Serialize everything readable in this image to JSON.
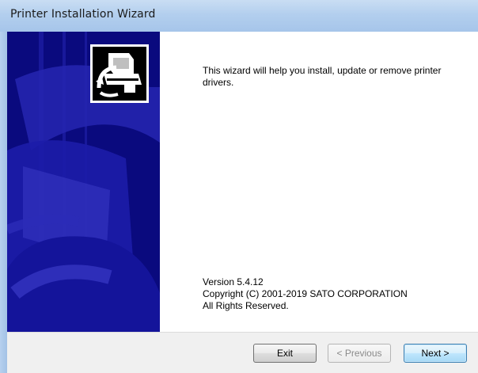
{
  "window": {
    "title": "Printer Installation Wizard"
  },
  "content": {
    "intro": "This wizard will help you install, update or remove printer drivers.",
    "version": "Version 5.4.12",
    "copyright": "Copyright (C) 2001-2019 SATO CORPORATION",
    "rights": "All Rights Reserved."
  },
  "buttons": {
    "exit": "Exit",
    "previous": "< Previous",
    "next": "Next >"
  },
  "icons": {
    "logo": "printer-installer-icon"
  },
  "colors": {
    "side_panel": "#0a0a7e",
    "title_bar": "#b3cfee",
    "footer": "#f0f0f0"
  }
}
